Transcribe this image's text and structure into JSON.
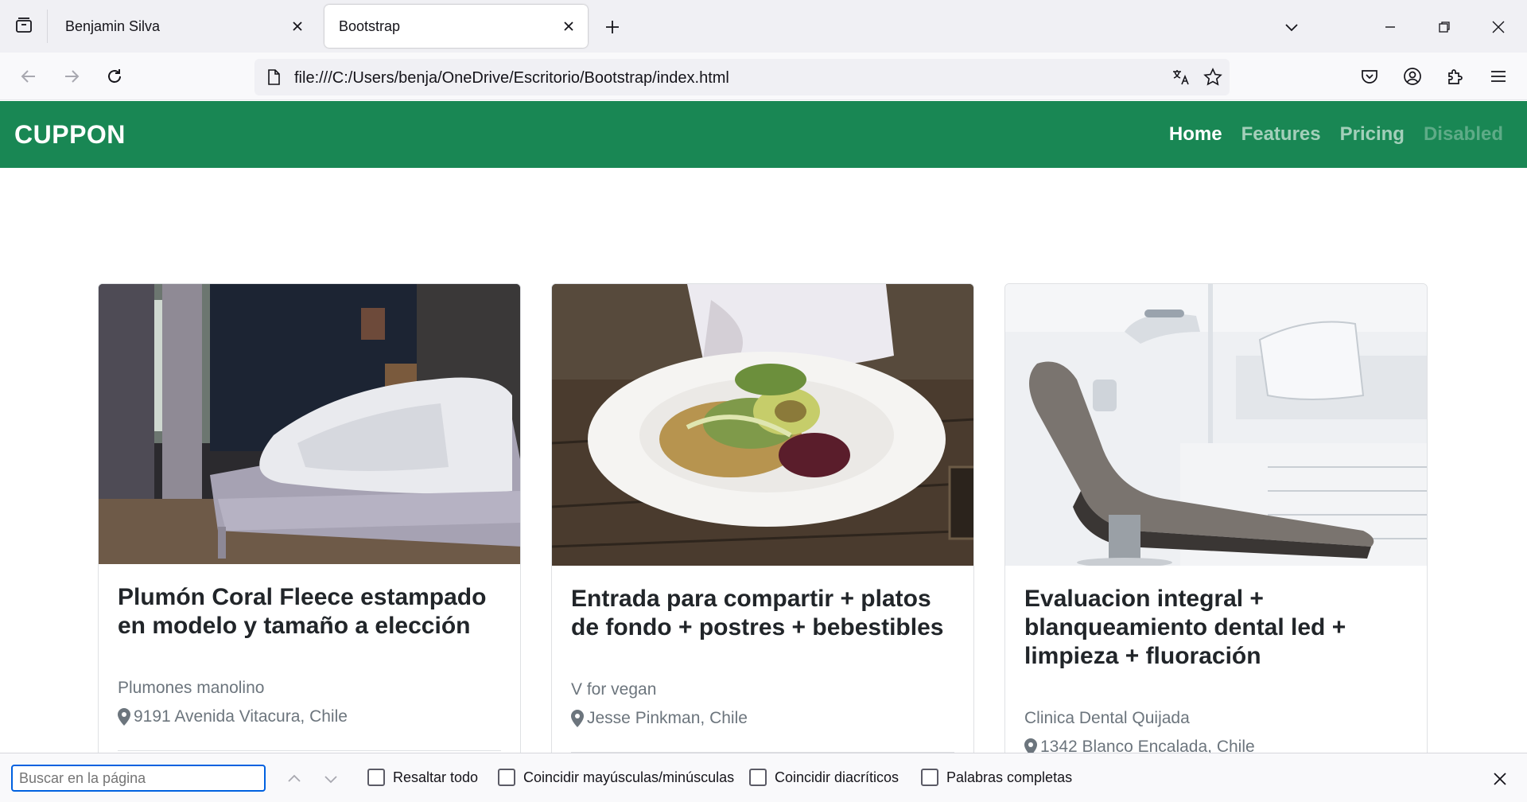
{
  "browser": {
    "tabs": [
      {
        "title": "Benjamin Silva",
        "active": false
      },
      {
        "title": "Bootstrap",
        "active": true
      }
    ],
    "url": "file:///C:/Users/benja/OneDrive/Escritorio/Bootstrap/index.html"
  },
  "site": {
    "brand": "CUPPON",
    "nav": [
      {
        "label": "Home",
        "state": "active"
      },
      {
        "label": "Features",
        "state": "normal"
      },
      {
        "label": "Pricing",
        "state": "normal"
      },
      {
        "label": "Disabled",
        "state": "disabled"
      }
    ],
    "accent_color": "#198754"
  },
  "cards": [
    {
      "title": "Plumón Coral Fleece estampado en modelo y tamaño a elección",
      "shop": "Plumones manolino",
      "address": "9191 Avenida Vitacura, Chile",
      "image": "bedroom-photo"
    },
    {
      "title": "Entrada para compartir + platos de fondo + postres + bebestibles",
      "shop": "V for vegan",
      "address": "Jesse Pinkman, Chile",
      "image": "salad-plate-photo"
    },
    {
      "title": "Evaluacion integral + blanqueamiento dental led + limpieza + fluoración",
      "shop": "Clinica Dental Quijada",
      "address": "1342 Blanco Encalada, Chile",
      "image": "dental-chair-photo"
    }
  ],
  "findbar": {
    "placeholder": "Buscar en la página",
    "options": [
      "Resaltar todo",
      "Coincidir mayúsculas/minúsculas",
      "Coincidir diacríticos",
      "Palabras completas"
    ]
  }
}
